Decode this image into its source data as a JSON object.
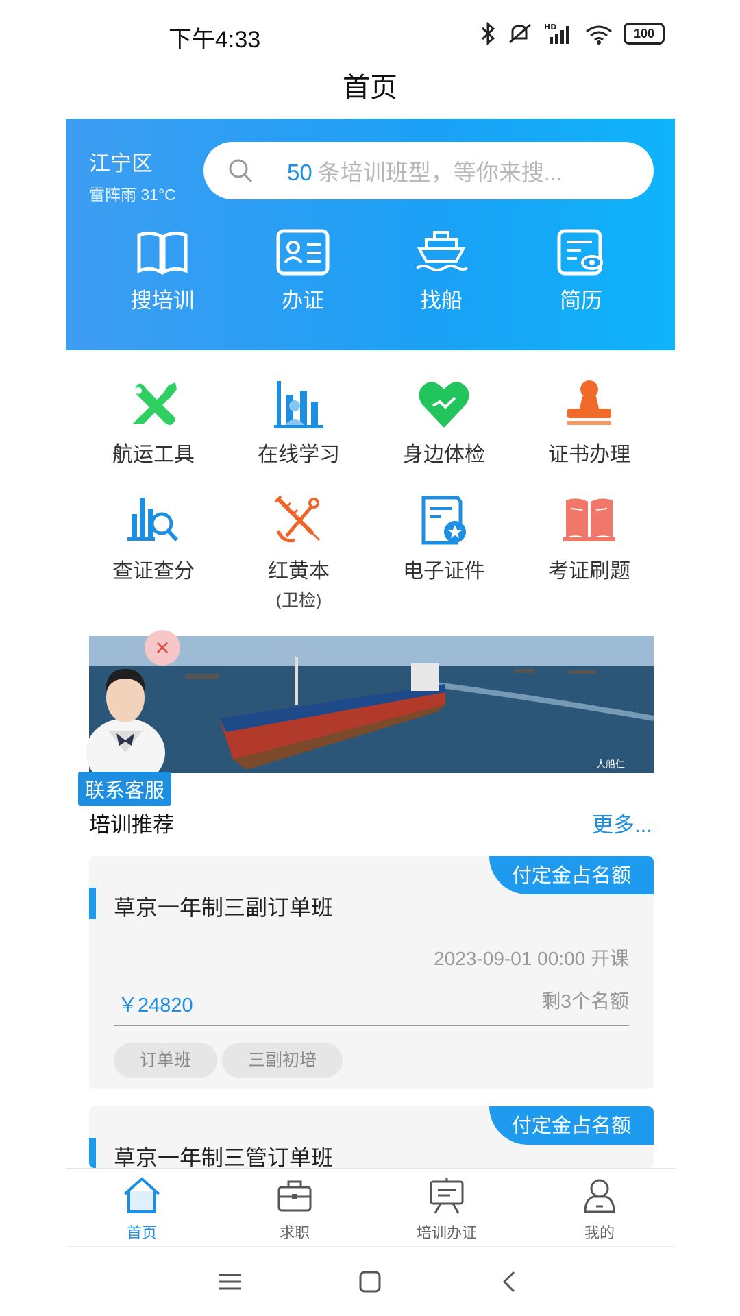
{
  "status_bar": {
    "time": "下午4:33",
    "battery": "100",
    "icons": [
      "bluetooth-icon",
      "mute-icon",
      "hd-signal-icon",
      "wifi-icon",
      "battery-icon"
    ]
  },
  "page": {
    "title": "首页"
  },
  "header": {
    "district": "江宁区",
    "weather": "雷阵雨 31°C",
    "search": {
      "count": "50",
      "placeholder": "条培训班型，等你来搜..."
    },
    "items": [
      {
        "label": "搜培训",
        "icon": "book-icon"
      },
      {
        "label": "办证",
        "icon": "id-card-icon"
      },
      {
        "label": "找船",
        "icon": "ship-icon"
      },
      {
        "label": "简历",
        "icon": "resume-icon"
      }
    ]
  },
  "grid": [
    {
      "label": "航运工具",
      "icon": "tools-icon"
    },
    {
      "label": "在线学习",
      "icon": "online-learning-icon"
    },
    {
      "label": "身边体检",
      "icon": "health-heart-icon"
    },
    {
      "label": "证书办理",
      "icon": "stamp-icon"
    },
    {
      "label": "查证查分",
      "icon": "chart-search-icon"
    },
    {
      "label": "红黄本",
      "sub": "(卫检)",
      "icon": "anchor-syringe-icon"
    },
    {
      "label": "电子证件",
      "icon": "e-certificate-icon"
    },
    {
      "label": "考证刷题",
      "icon": "open-book-icon"
    }
  ],
  "banner": {
    "service_label": "联系客服",
    "close": "×",
    "watermark": "人船仁"
  },
  "section": {
    "title": "培训推荐",
    "more": "更多..."
  },
  "cards": [
    {
      "ribbon": "付定金占名额",
      "title": "草京一年制三副订单班",
      "date": "2023-09-01 00:00 开课",
      "price": "￥24820",
      "remaining": "剩3个名额",
      "tags": [
        "订单班",
        "三副初培"
      ]
    },
    {
      "ribbon": "付定金占名额",
      "title": "草京一年制三管订单班"
    }
  ],
  "bottom_nav": [
    {
      "label": "首页",
      "icon": "home-icon",
      "active": true
    },
    {
      "label": "求职",
      "icon": "briefcase-icon"
    },
    {
      "label": "培训办证",
      "icon": "training-board-icon"
    },
    {
      "label": "我的",
      "icon": "profile-icon"
    }
  ],
  "colors": {
    "accent": "#1e9bef",
    "header_start": "#3e9df2",
    "header_end": "#0fb4fb"
  }
}
